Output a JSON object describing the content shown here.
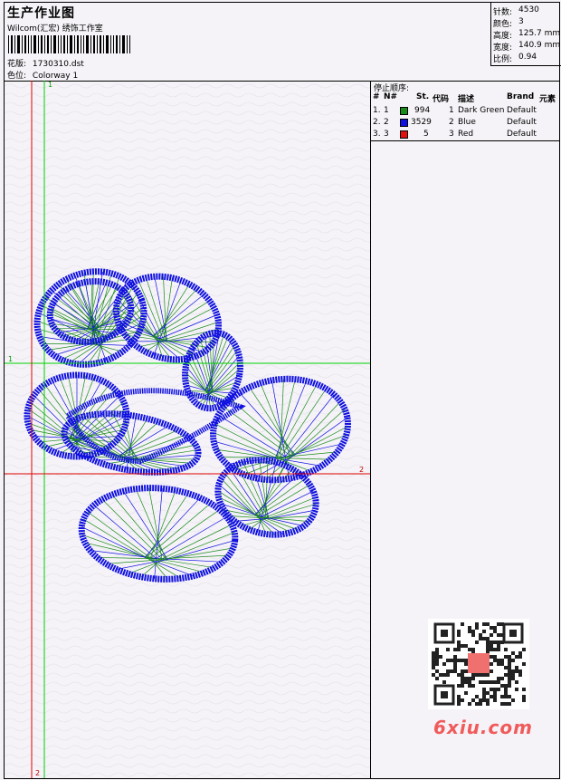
{
  "header": {
    "title": "生产作业图",
    "subtitle": "Wilcom(汇宏) 绣饰工作室",
    "design_label": "花版:",
    "design_value": "1730310.dst",
    "colorway_label": "色位:",
    "colorway_value": "Colorway 1"
  },
  "stats": {
    "stitches_label": "针数:",
    "stitches_value": "4530",
    "colors_label": "颜色:",
    "colors_value": "3",
    "height_label": "高度:",
    "height_value": "125.7 mm",
    "width_label": "宽度:",
    "width_value": "140.9 mm",
    "scale_label": "比例:",
    "scale_value": "0.94"
  },
  "stops": {
    "title": "停止顺序:",
    "headers": {
      "num": "#",
      "n": "N#",
      "st": "St.",
      "code": "代码",
      "desc": "描述",
      "brand": "Brand",
      "elem": "元素"
    },
    "rows": [
      {
        "num": "1.",
        "n": "1",
        "color": "#1a8a1a",
        "st": "994",
        "code": "1",
        "desc": "Dark Green",
        "brand": "Default"
      },
      {
        "num": "2.",
        "n": "2",
        "color": "#1010e0",
        "st": "3529",
        "code": "2",
        "desc": "Blue",
        "brand": "Default"
      },
      {
        "num": "3.",
        "n": "3",
        "color": "#e01010",
        "st": "5",
        "code": "3",
        "desc": "Red",
        "brand": "Default"
      }
    ]
  },
  "guides": {
    "green_top": "1",
    "green_left": "1",
    "red_right": "2",
    "red_bottom": "2"
  },
  "watermark": {
    "text": "6xiu.com",
    "seal": "汉印"
  },
  "colors": {
    "green": "#1a8a1a",
    "blue": "#1010e0",
    "red": "#e01010",
    "guide_green": "#00d000",
    "guide_red": "#e00000"
  }
}
